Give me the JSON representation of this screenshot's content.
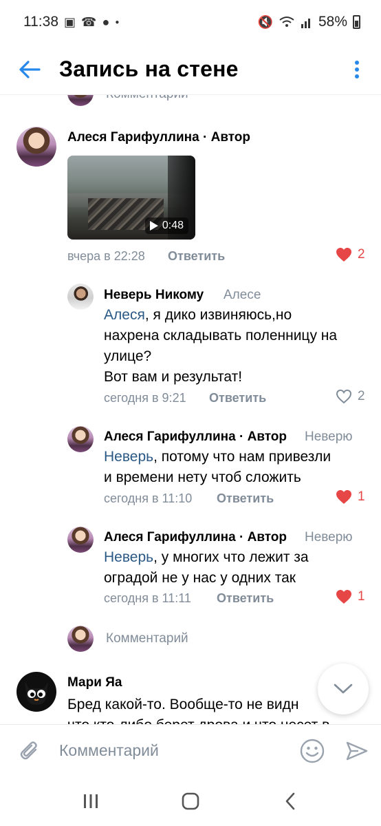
{
  "status_bar": {
    "time": "11:38",
    "battery": "58%"
  },
  "header": {
    "title": "Запись на стене"
  },
  "top_partial": {
    "placeholder": "Комментарий"
  },
  "comments": [
    {
      "author": "Алеся Гарифуллина · Автор",
      "video_duration": "0:48",
      "time": "вчера в 22:28",
      "reply_label": "Ответить",
      "likes": "2"
    },
    {
      "author": "Неверь Никому",
      "reply_to": "Алесе",
      "mention": "Алеся",
      "text_line1_rest": ", я дико извиняюсь,но",
      "text_line2": "нахрена складывать поленницу на",
      "text_line3": "улице?",
      "text_line4": "Вот вам и результат!",
      "time": "сегодня в 9:21",
      "reply_label": "Ответить",
      "likes": "2"
    },
    {
      "author": "Алеся Гарифуллина · Автор",
      "reply_to": "Неверю",
      "mention": "Неверь",
      "text_line1_rest": ", потому что нам привезли",
      "text_line2": "и времени нету чтоб сложить",
      "time": "сегодня в 11:10",
      "reply_label": "Ответить",
      "likes": "1"
    },
    {
      "author": "Алеся Гарифуллина · Автор",
      "reply_to": "Неверю",
      "mention": "Неверь",
      "text_line1_rest": ", у многих что лежит за",
      "text_line2": "оградой не у нас у одних так",
      "time": "сегодня в 11:11",
      "reply_label": "Ответить",
      "likes": "1"
    },
    {
      "placeholder": "Комментарий"
    },
    {
      "author": "Мари Яа",
      "text_line1": "Бред какой-то. Вообще-то не видн",
      "text_line2": "что кто-либо берет дрова и что несет в"
    }
  ],
  "composer": {
    "placeholder": "Комментарий"
  },
  "colors": {
    "accent": "#2688EB",
    "like_red": "#E64646",
    "secondary_text": "#818C99",
    "mention": "#2A5885"
  }
}
